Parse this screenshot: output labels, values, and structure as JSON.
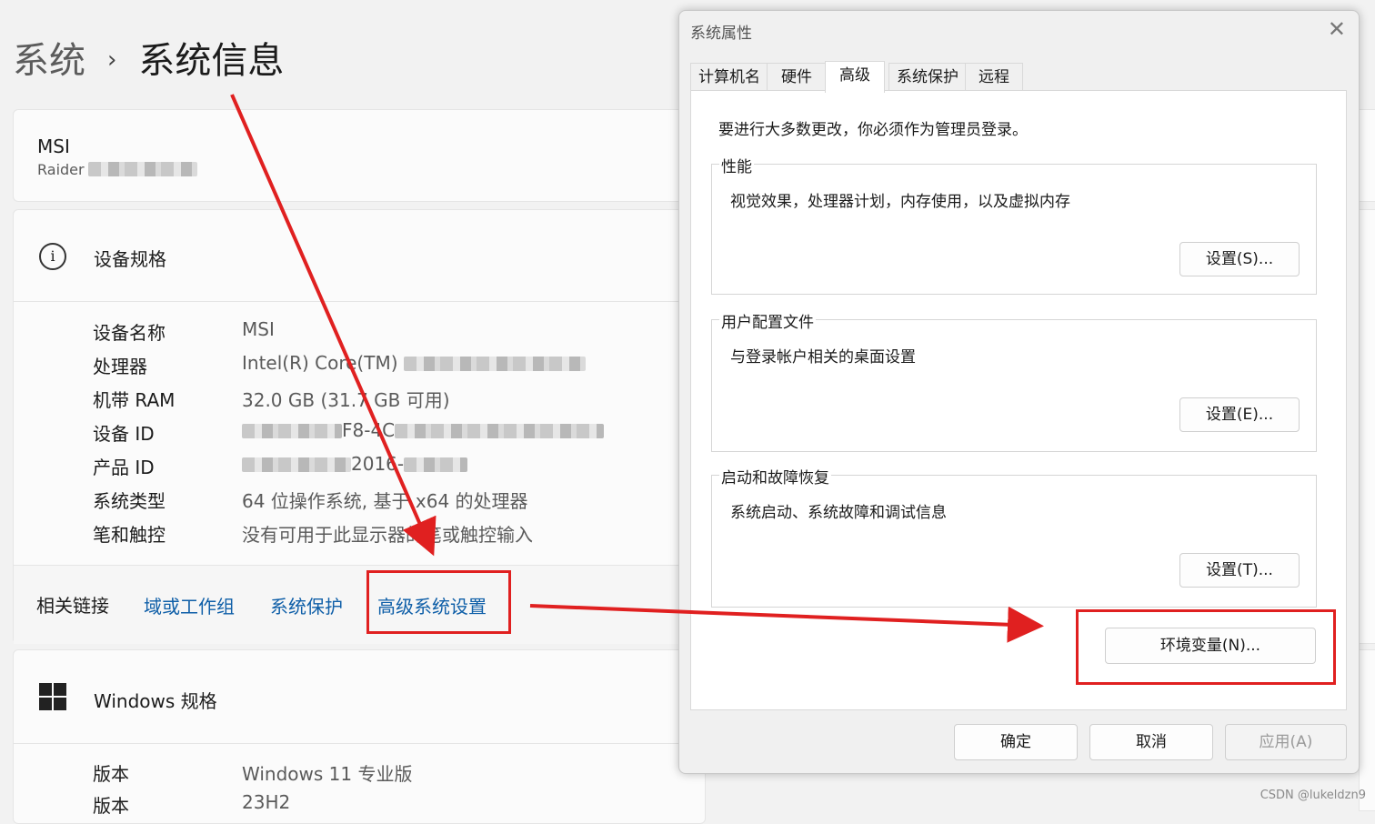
{
  "breadcrumb": {
    "parent": "系统",
    "separator": "›",
    "current": "系统信息"
  },
  "device_card": {
    "name": "MSI",
    "model": "Raider"
  },
  "specs": {
    "header": "设备规格",
    "rows": [
      {
        "label": "设备名称",
        "value": "MSI"
      },
      {
        "label": "处理器",
        "value": "Intel(R) Core(TM)"
      },
      {
        "label": "机带 RAM",
        "value": "32.0 GB (31.7 GB 可用)"
      },
      {
        "label": "设备 ID",
        "value": "F8-4C"
      },
      {
        "label": "产品 ID",
        "value": "2016-"
      },
      {
        "label": "系统类型",
        "value": "64 位操作系统, 基于 x64 的处理器"
      },
      {
        "label": "笔和触控",
        "value": "没有可用于此显示器的笔或触控输入"
      }
    ]
  },
  "related_links": {
    "label": "相关链接",
    "links": [
      "域或工作组",
      "系统保护",
      "高级系统设置"
    ]
  },
  "windows_specs": {
    "header": "Windows 规格",
    "rows": [
      {
        "label": "版本",
        "value": "Windows 11 专业版"
      },
      {
        "label": "版本",
        "value": "23H2"
      }
    ]
  },
  "dialog": {
    "title": "系统属性",
    "close_glyph": "✕",
    "tabs": [
      "计算机名",
      "硬件",
      "高级",
      "系统保护",
      "远程"
    ],
    "active_tab": "高级",
    "admin_note": "要进行大多数更改，你必须作为管理员登录。",
    "groups": [
      {
        "label": "性能",
        "desc": "视觉效果，处理器计划，内存使用，以及虚拟内存",
        "button": "设置(S)..."
      },
      {
        "label": "用户配置文件",
        "desc": "与登录帐户相关的桌面设置",
        "button": "设置(E)..."
      },
      {
        "label": "启动和故障恢复",
        "desc": "系统启动、系统故障和调试信息",
        "button": "设置(T)..."
      }
    ],
    "env_button": "环境变量(N)...",
    "footer": {
      "ok": "确定",
      "cancel": "取消",
      "apply": "应用(A)"
    }
  },
  "watermark": "CSDN @lukeldzn9",
  "colors": {
    "annotation_red": "#e02020",
    "link_blue": "#0f5fa8"
  }
}
